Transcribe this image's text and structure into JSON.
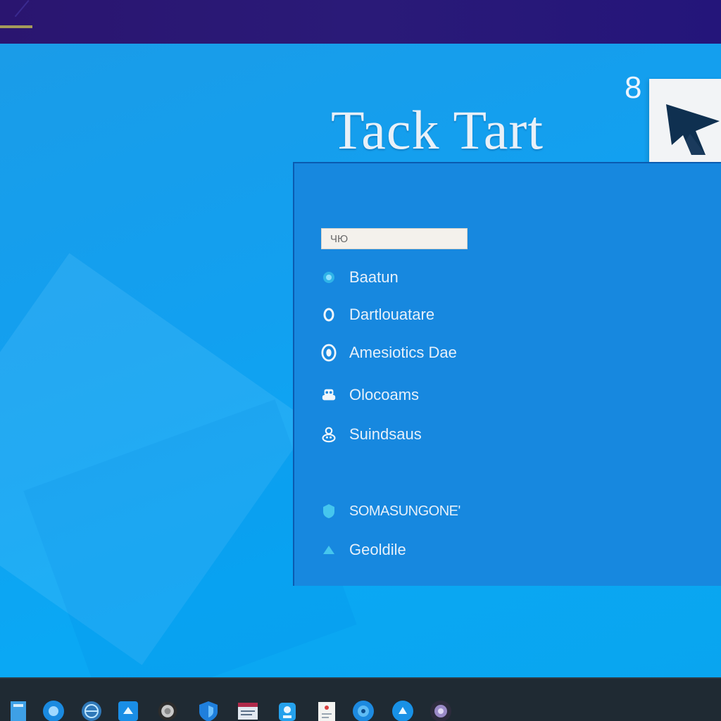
{
  "app": {
    "title": "Tack Tart",
    "corner_number": "8"
  },
  "search": {
    "value": "ЧЮ"
  },
  "menu": [
    {
      "label": "Baatun",
      "icon": "dot-icon"
    },
    {
      "label": "Dartlouatare",
      "icon": "ring-icon"
    },
    {
      "label": "Amesiotics Dae",
      "icon": "target-icon"
    },
    {
      "label": "Olocoams",
      "icon": "bot-icon"
    },
    {
      "label": "Suindsaus",
      "icon": "user-icon"
    },
    {
      "label": "SOMASUNGONE'",
      "icon": "shield-icon"
    },
    {
      "label": "Geoldile",
      "icon": "triangle-icon"
    }
  ],
  "colors": {
    "title_bar": "#2a1570",
    "desktop": "#12a0f0",
    "panel": "#1788df",
    "taskbar": "#1f2a33"
  },
  "taskbar_icons": [
    "app-icon",
    "blue-circle-icon",
    "globe-icon",
    "settings-icon",
    "clock-icon",
    "shield-app-icon",
    "mail-icon",
    "store-icon",
    "note-icon",
    "browser-icon",
    "chat-icon",
    "media-icon"
  ]
}
